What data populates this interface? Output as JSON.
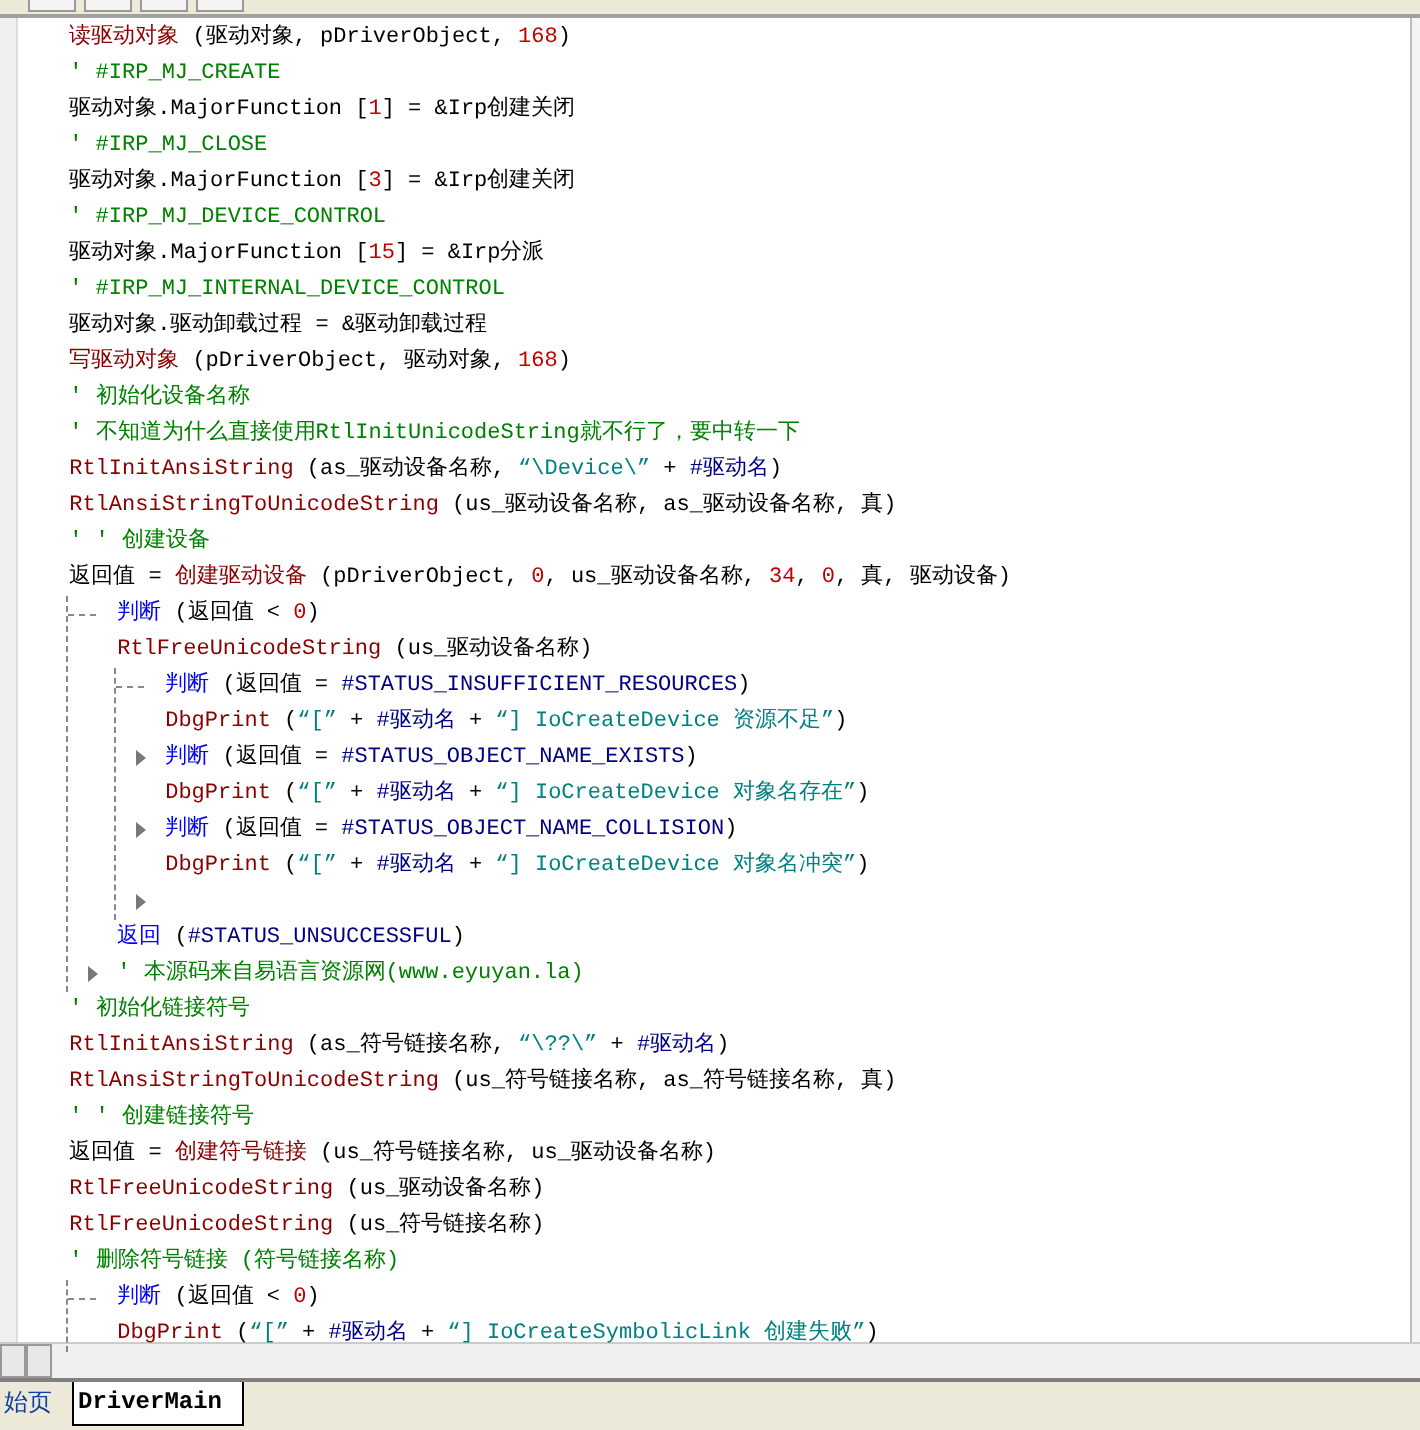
{
  "toolbar": {
    "buttons": [
      {
        "kind": "plain"
      },
      {
        "kind": "plain"
      },
      {
        "kind": "plain"
      },
      {
        "kind": "plain"
      }
    ]
  },
  "code": [
    {
      "kind": "line",
      "tokens": [
        {
          "text": "读驱动对象",
          "kind": "cmd"
        },
        {
          "text": " (驱动对象, pDriverObject, ",
          "kind": "plain"
        },
        {
          "text": "168",
          "kind": "num"
        },
        {
          "text": ")",
          "kind": "plain"
        }
      ]
    },
    {
      "kind": "line",
      "tokens": [
        {
          "text": "' #IRP_MJ_CREATE",
          "kind": "comment"
        }
      ]
    },
    {
      "kind": "line",
      "tokens": [
        {
          "text": "驱动对象.MajorFunction [",
          "kind": "plain"
        },
        {
          "text": "1",
          "kind": "num"
        },
        {
          "text": "] = &Irp创建关闭",
          "kind": "plain"
        }
      ]
    },
    {
      "kind": "line",
      "tokens": [
        {
          "text": "' #IRP_MJ_CLOSE",
          "kind": "comment"
        }
      ]
    },
    {
      "kind": "line",
      "tokens": [
        {
          "text": "驱动对象.MajorFunction [",
          "kind": "plain"
        },
        {
          "text": "3",
          "kind": "num"
        },
        {
          "text": "] = &Irp创建关闭",
          "kind": "plain"
        }
      ]
    },
    {
      "kind": "line",
      "tokens": [
        {
          "text": "' #IRP_MJ_DEVICE_CONTROL",
          "kind": "comment"
        }
      ]
    },
    {
      "kind": "line",
      "tokens": [
        {
          "text": "驱动对象.MajorFunction [",
          "kind": "plain"
        },
        {
          "text": "15",
          "kind": "num"
        },
        {
          "text": "] = &Irp分派",
          "kind": "plain"
        }
      ]
    },
    {
      "kind": "line",
      "tokens": [
        {
          "text": "' #IRP_MJ_INTERNAL_DEVICE_CONTROL",
          "kind": "comment"
        }
      ]
    },
    {
      "kind": "line",
      "tokens": [
        {
          "text": "驱动对象.驱动卸载过程 = &驱动卸载过程",
          "kind": "plain"
        }
      ]
    },
    {
      "kind": "line",
      "tokens": [
        {
          "text": "写驱动对象",
          "kind": "cmd"
        },
        {
          "text": " (pDriverObject, 驱动对象, ",
          "kind": "plain"
        },
        {
          "text": "168",
          "kind": "num"
        },
        {
          "text": ")",
          "kind": "plain"
        }
      ]
    },
    {
      "kind": "line",
      "tokens": [
        {
          "text": "' 初始化设备名称",
          "kind": "comment"
        }
      ]
    },
    {
      "kind": "line",
      "tokens": [
        {
          "text": "' 不知道为什么直接使用RtlInitUnicodeString就不行了，要中转一下",
          "kind": "comment"
        }
      ]
    },
    {
      "kind": "line",
      "tokens": [
        {
          "text": "RtlInitAnsiString",
          "kind": "cmd"
        },
        {
          "text": " (as_驱动设备名称, ",
          "kind": "plain"
        },
        {
          "text": "“\\Device\\”",
          "kind": "string"
        },
        {
          "text": " + ",
          "kind": "plain"
        },
        {
          "text": "#驱动名",
          "kind": "const"
        },
        {
          "text": ")",
          "kind": "plain"
        }
      ]
    },
    {
      "kind": "line",
      "tokens": [
        {
          "text": "RtlAnsiStringToUnicodeString",
          "kind": "cmd"
        },
        {
          "text": " (us_驱动设备名称, as_驱动设备名称, 真)",
          "kind": "plain"
        }
      ]
    },
    {
      "kind": "line",
      "tokens": [
        {
          "text": "' ' 创建设备",
          "kind": "comment"
        }
      ]
    },
    {
      "kind": "line",
      "tokens": [
        {
          "text": "返回值 = ",
          "kind": "plain"
        },
        {
          "text": "创建驱动设备",
          "kind": "cmd"
        },
        {
          "text": " (pDriverObject, ",
          "kind": "plain"
        },
        {
          "text": "0",
          "kind": "num"
        },
        {
          "text": ", us_驱动设备名称, ",
          "kind": "plain"
        },
        {
          "text": "34",
          "kind": "num"
        },
        {
          "text": ", ",
          "kind": "plain"
        },
        {
          "text": "0",
          "kind": "num"
        },
        {
          "text": ", 真, 驱动设备)",
          "kind": "plain"
        }
      ]
    },
    {
      "kind": "block",
      "children": [
        {
          "kind": "line",
          "tokens": [
            {
              "text": "判断",
              "kind": "keyword"
            },
            {
              "text": " (返回值 < ",
              "kind": "plain"
            },
            {
              "text": "0",
              "kind": "num"
            },
            {
              "text": ")",
              "kind": "plain"
            }
          ]
        },
        {
          "kind": "line",
          "tokens": [
            {
              "text": "RtlFreeUnicodeString",
              "kind": "cmd"
            },
            {
              "text": " (us_驱动设备名称)",
              "kind": "plain"
            }
          ]
        },
        {
          "kind": "block",
          "children": [
            {
              "kind": "line",
              "tokens": [
                {
                  "text": "判断",
                  "kind": "keyword"
                },
                {
                  "text": " (返回值 = ",
                  "kind": "plain"
                },
                {
                  "text": "#STATUS_INSUFFICIENT_RESOURCES",
                  "kind": "const"
                },
                {
                  "text": ")",
                  "kind": "plain"
                }
              ]
            },
            {
              "kind": "line",
              "tokens": [
                {
                  "text": "DbgPrint",
                  "kind": "cmd"
                },
                {
                  "text": " (",
                  "kind": "plain"
                },
                {
                  "text": "“[”",
                  "kind": "string"
                },
                {
                  "text": " + ",
                  "kind": "plain"
                },
                {
                  "text": "#驱动名",
                  "kind": "const"
                },
                {
                  "text": " + ",
                  "kind": "plain"
                },
                {
                  "text": "“] IoCreateDevice 资源不足”",
                  "kind": "string"
                },
                {
                  "text": ")",
                  "kind": "plain"
                }
              ]
            },
            {
              "kind": "fold",
              "tokens": [
                {
                  "text": "判断",
                  "kind": "keyword"
                },
                {
                  "text": " (返回值 = ",
                  "kind": "plain"
                },
                {
                  "text": "#STATUS_OBJECT_NAME_EXISTS",
                  "kind": "const"
                },
                {
                  "text": ")",
                  "kind": "plain"
                }
              ]
            },
            {
              "kind": "line",
              "tokens": [
                {
                  "text": "DbgPrint",
                  "kind": "cmd"
                },
                {
                  "text": " (",
                  "kind": "plain"
                },
                {
                  "text": "“[”",
                  "kind": "string"
                },
                {
                  "text": " + ",
                  "kind": "plain"
                },
                {
                  "text": "#驱动名",
                  "kind": "const"
                },
                {
                  "text": " + ",
                  "kind": "plain"
                },
                {
                  "text": "“] IoCreateDevice 对象名存在”",
                  "kind": "string"
                },
                {
                  "text": ")",
                  "kind": "plain"
                }
              ]
            },
            {
              "kind": "fold",
              "tokens": [
                {
                  "text": "判断",
                  "kind": "keyword"
                },
                {
                  "text": " (返回值 = ",
                  "kind": "plain"
                },
                {
                  "text": "#STATUS_OBJECT_NAME_COLLISION",
                  "kind": "const"
                },
                {
                  "text": ")",
                  "kind": "plain"
                }
              ]
            },
            {
              "kind": "line",
              "tokens": [
                {
                  "text": "DbgPrint",
                  "kind": "cmd"
                },
                {
                  "text": " (",
                  "kind": "plain"
                },
                {
                  "text": "“[”",
                  "kind": "string"
                },
                {
                  "text": " + ",
                  "kind": "plain"
                },
                {
                  "text": "#驱动名",
                  "kind": "const"
                },
                {
                  "text": " + ",
                  "kind": "plain"
                },
                {
                  "text": "“] IoCreateDevice 对象名冲突”",
                  "kind": "string"
                },
                {
                  "text": ")",
                  "kind": "plain"
                }
              ]
            },
            {
              "kind": "end"
            }
          ]
        },
        {
          "kind": "line",
          "tokens": [
            {
              "text": "返回",
              "kind": "keyword"
            },
            {
              "text": " (",
              "kind": "plain"
            },
            {
              "text": "#STATUS_UNSUCCESSFUL",
              "kind": "const"
            },
            {
              "text": ")",
              "kind": "plain"
            }
          ]
        },
        {
          "kind": "fold",
          "tokens": [
            {
              "text": "' 本源码来自易语言资源网(www.eyuyan.la)",
              "kind": "comment"
            }
          ]
        }
      ]
    },
    {
      "kind": "line",
      "tokens": [
        {
          "text": "' 初始化链接符号",
          "kind": "comment"
        }
      ]
    },
    {
      "kind": "line",
      "tokens": [
        {
          "text": "RtlInitAnsiString",
          "kind": "cmd"
        },
        {
          "text": " (as_符号链接名称, ",
          "kind": "plain"
        },
        {
          "text": "“\\??\\”",
          "kind": "string"
        },
        {
          "text": " + ",
          "kind": "plain"
        },
        {
          "text": "#驱动名",
          "kind": "const"
        },
        {
          "text": ")",
          "kind": "plain"
        }
      ]
    },
    {
      "kind": "line",
      "tokens": [
        {
          "text": "RtlAnsiStringToUnicodeString",
          "kind": "cmd"
        },
        {
          "text": " (us_符号链接名称, as_符号链接名称, 真)",
          "kind": "plain"
        }
      ]
    },
    {
      "kind": "line",
      "tokens": [
        {
          "text": "' ' 创建链接符号",
          "kind": "comment"
        }
      ]
    },
    {
      "kind": "line",
      "tokens": [
        {
          "text": "返回值 = ",
          "kind": "plain"
        },
        {
          "text": "创建符号链接",
          "kind": "cmd"
        },
        {
          "text": " (us_符号链接名称, us_驱动设备名称)",
          "kind": "plain"
        }
      ]
    },
    {
      "kind": "line",
      "tokens": [
        {
          "text": "RtlFreeUnicodeString",
          "kind": "cmd"
        },
        {
          "text": " (us_驱动设备名称)",
          "kind": "plain"
        }
      ]
    },
    {
      "kind": "line",
      "tokens": [
        {
          "text": "RtlFreeUnicodeString",
          "kind": "cmd"
        },
        {
          "text": " (us_符号链接名称)",
          "kind": "plain"
        }
      ]
    },
    {
      "kind": "line",
      "tokens": [
        {
          "text": "' 删除符号链接 (符号链接名称)",
          "kind": "comment"
        }
      ]
    },
    {
      "kind": "block",
      "children": [
        {
          "kind": "line",
          "tokens": [
            {
              "text": "判断",
              "kind": "keyword"
            },
            {
              "text": " (返回值 < ",
              "kind": "plain"
            },
            {
              "text": "0",
              "kind": "num"
            },
            {
              "text": ")",
              "kind": "plain"
            }
          ]
        },
        {
          "kind": "line",
          "tokens": [
            {
              "text": "DbgPrint",
              "kind": "cmd"
            },
            {
              "text": " (",
              "kind": "plain"
            },
            {
              "text": "“[”",
              "kind": "string"
            },
            {
              "text": " + ",
              "kind": "plain"
            },
            {
              "text": "#驱动名",
              "kind": "const"
            },
            {
              "text": " + ",
              "kind": "plain"
            },
            {
              "text": "“] IoCreateSymbolicLink 创建失败”",
              "kind": "string"
            },
            {
              "text": ")",
              "kind": "plain"
            }
          ]
        }
      ]
    }
  ],
  "tabs": [
    {
      "label": "始页",
      "selected": false
    },
    {
      "label": "DriverMain",
      "selected": true
    }
  ]
}
